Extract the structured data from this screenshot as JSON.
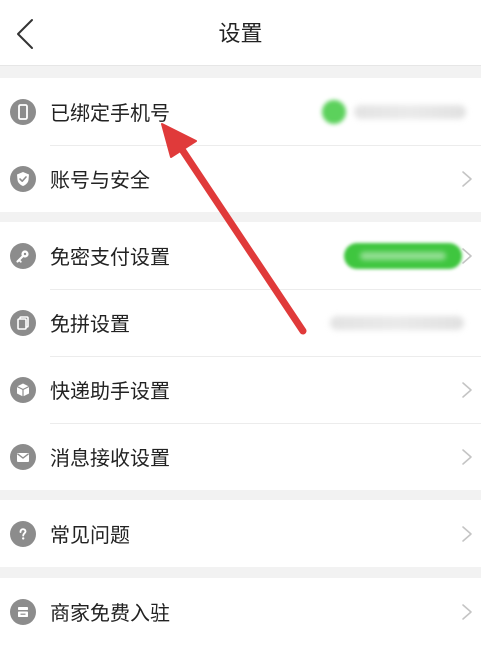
{
  "header": {
    "title": "设置",
    "back_icon": "chevron-left-icon"
  },
  "groups": [
    {
      "items": [
        {
          "label": "已绑定手机号",
          "icon": "phone-icon"
        },
        {
          "label": "账号与安全",
          "icon": "shield-check-icon"
        }
      ]
    },
    {
      "items": [
        {
          "label": "免密支付设置",
          "icon": "key-icon"
        },
        {
          "label": "免拼设置",
          "icon": "copy-icon"
        },
        {
          "label": "快递助手设置",
          "icon": "package-icon"
        },
        {
          "label": "消息接收设置",
          "icon": "mail-icon"
        }
      ]
    },
    {
      "items": [
        {
          "label": "常见问题",
          "icon": "question-icon"
        }
      ]
    },
    {
      "items": [
        {
          "label": "商家免费入驻",
          "icon": "store-icon"
        }
      ]
    }
  ],
  "colors": {
    "background": "#f2f2f2",
    "surface": "#ffffff",
    "icon_gray": "#8c8c8c",
    "accent_green": "#3fc63f",
    "annotation_red": "#e03a3a"
  }
}
